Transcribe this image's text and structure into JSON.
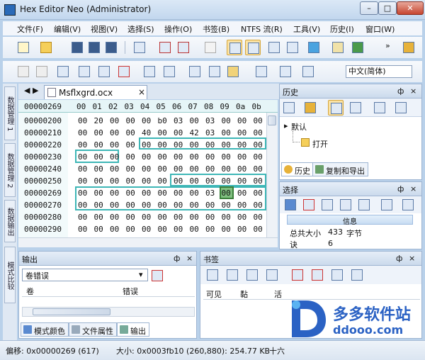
{
  "window": {
    "title": "Hex Editor Neo (Administrator)",
    "controls": {
      "minimize": "–",
      "maximize": "□",
      "close": "✕"
    }
  },
  "menu": [
    "文件(F)",
    "编辑(V)",
    "视图(V)",
    "选择(S)",
    "操作(O)",
    "书签(B)",
    "NTFS 流(R)",
    "工具(V)",
    "历史(I)",
    "窗口(W)"
  ],
  "toolbar": {
    "language_select": "中文(简体)",
    "overflow": "»"
  },
  "sidebar": {
    "tabs": [
      "数据管理 1",
      "数据管理 2",
      "数据输出",
      "模式比较"
    ]
  },
  "editor": {
    "tab_label": "Msflxgrd.ocx",
    "tab_close": "×",
    "nav_arrows": [
      "◀",
      "▶"
    ],
    "header_offset": "00000269",
    "header_cols": [
      "00",
      "01",
      "02",
      "03",
      "04",
      "05",
      "06",
      "07",
      "08",
      "09",
      "0a",
      "0b"
    ],
    "rows": [
      {
        "offset": "00000200",
        "bytes": [
          "00",
          "20",
          "00",
          "00",
          "00",
          "b0",
          "03",
          "00",
          "03",
          "00",
          "00",
          "00"
        ]
      },
      {
        "offset": "00000210",
        "bytes": [
          "00",
          "00",
          "00",
          "00",
          "40",
          "00",
          "00",
          "42",
          "03",
          "00",
          "00",
          "00"
        ]
      },
      {
        "offset": "00000220",
        "bytes": [
          "00",
          "00",
          "00",
          "00",
          "00",
          "00",
          "00",
          "00",
          "00",
          "00",
          "00",
          "00"
        ]
      },
      {
        "offset": "00000230",
        "bytes": [
          "00",
          "00",
          "00",
          "00",
          "00",
          "00",
          "00",
          "00",
          "00",
          "00",
          "00",
          "00"
        ]
      },
      {
        "offset": "00000240",
        "bytes": [
          "00",
          "00",
          "00",
          "00",
          "00",
          "00",
          "00",
          "00",
          "00",
          "00",
          "00",
          "00"
        ]
      },
      {
        "offset": "00000250",
        "bytes": [
          "00",
          "00",
          "00",
          "00",
          "00",
          "00",
          "00",
          "00",
          "00",
          "00",
          "00",
          "00"
        ]
      },
      {
        "offset": "00000269",
        "bytes": [
          "00",
          "00",
          "00",
          "00",
          "00",
          "00",
          "00",
          "00",
          "03",
          "00",
          "00",
          "00"
        ]
      },
      {
        "offset": "00000270",
        "bytes": [
          "00",
          "00",
          "00",
          "00",
          "00",
          "00",
          "00",
          "00",
          "00",
          "00",
          "00",
          "00"
        ]
      },
      {
        "offset": "00000280",
        "bytes": [
          "00",
          "00",
          "00",
          "00",
          "00",
          "00",
          "00",
          "00",
          "00",
          "00",
          "00",
          "00"
        ]
      },
      {
        "offset": "00000290",
        "bytes": [
          "00",
          "00",
          "00",
          "00",
          "00",
          "00",
          "00",
          "00",
          "00",
          "00",
          "00",
          "00"
        ]
      }
    ]
  },
  "history_panel": {
    "title": "历史",
    "default_label": "默认",
    "open_label": "打开",
    "tabs": [
      "历史",
      "复制和导出"
    ]
  },
  "selection_panel": {
    "title": "选择",
    "info_header": "信息",
    "total_size_label": "总共大小",
    "total_size_value": "433",
    "total_size_unit": "字节",
    "blocks_label": "块",
    "blocks_label_prefix": "诀",
    "blocks_value": "6"
  },
  "output_panel": {
    "title": "输出",
    "dropdown_value": "卷错误",
    "columns": [
      "卷",
      "错误"
    ],
    "bottom_tabs": [
      "模式颜色",
      "文件属性",
      "输出"
    ]
  },
  "bookmarks_panel": {
    "title": "书签",
    "columns": [
      "可见",
      "黏",
      "活"
    ]
  },
  "panel_controls": {
    "pin": "ф",
    "close": "×"
  },
  "status": {
    "offset": "偏移: 0x00000269 (617)",
    "size": "大小: 0x0003fb10 (260,880): 254.77 KB",
    "hex_mode": "十六"
  },
  "watermark": {
    "logo_letter": "D",
    "site_name": "多多软件站",
    "url": "ddooo.com"
  },
  "colors": {
    "accent": "#3db6b6",
    "title_bar": "#c2d7ee",
    "selection_fill": "#fbe3a6",
    "watermark_blue": "#2b62c4"
  }
}
